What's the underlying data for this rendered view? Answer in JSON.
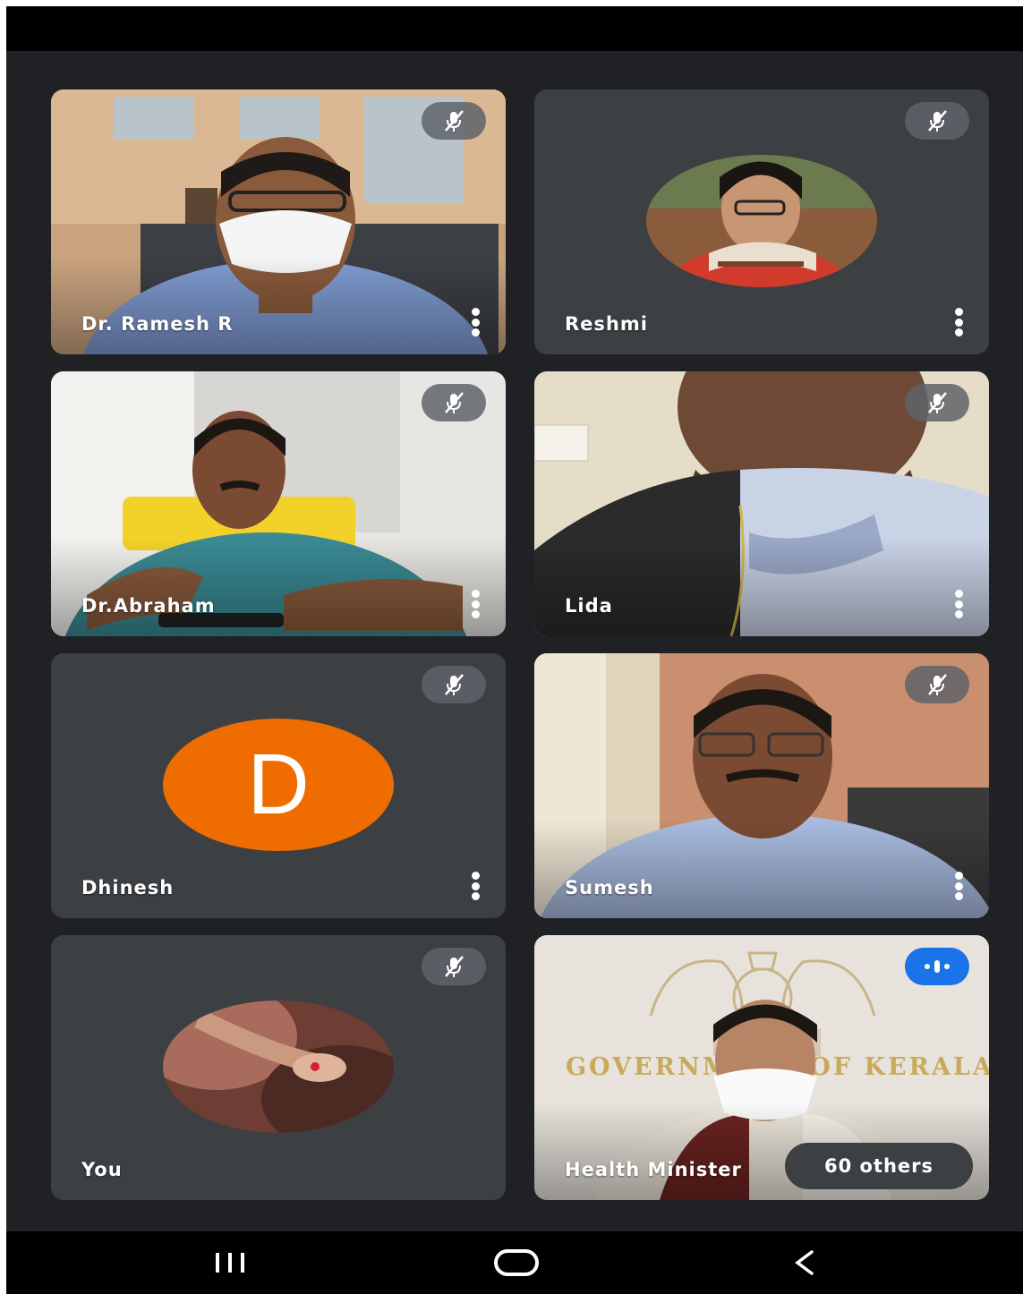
{
  "participants": [
    {
      "name": "Dr. Ramesh R",
      "muted": true
    },
    {
      "name": "Reshmi",
      "muted": true
    },
    {
      "name": "Dr.Abraham",
      "muted": true
    },
    {
      "name": "Lida",
      "muted": true
    },
    {
      "name": "Dhinesh",
      "muted": true,
      "avatar_letter": "D",
      "avatar_color": "#ef6c00"
    },
    {
      "name": "Sumesh",
      "muted": true
    },
    {
      "name": "You",
      "muted": true
    },
    {
      "name": "Health Minister",
      "muted": false,
      "speaking": true,
      "backdrop_text": "GOVERNMENT OF KERALA"
    }
  ],
  "others_label": "60 others",
  "icons": {
    "mute": "mic-off-icon",
    "speaking": "speaking-indicator-icon",
    "menu": "more-vert-icon",
    "nav_recents": "recents-icon",
    "nav_home": "home-icon",
    "nav_back": "back-icon"
  },
  "colors": {
    "background": "#202124",
    "tile": "#3c4043",
    "avatar_orange": "#ef6c00",
    "speaking_blue": "#1a73e8"
  }
}
